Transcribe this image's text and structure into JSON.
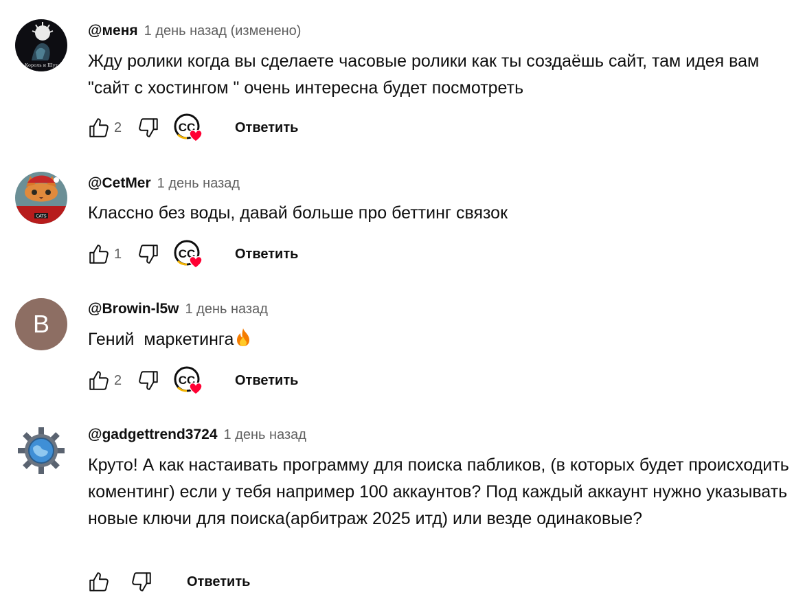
{
  "comments": [
    {
      "author": "@меня",
      "time": "1 день назад (изменено)",
      "text": "Жду ролики когда вы сделаете часовые ролики как ты создаёшь сайт, там идея вам \"сайт с хостингом \" очень интересна будет посмотреть",
      "likes": "2",
      "avatar_caption": "Король и Шут",
      "has_creator_heart": true,
      "reply_label": "Ответить"
    },
    {
      "author": "@CetMer",
      "time": "1 день назад",
      "text": "Классно без воды, давай больше про беттинг связок",
      "likes": "1",
      "avatar_caption": "CATS",
      "has_creator_heart": true,
      "reply_label": "Ответить"
    },
    {
      "author": "@Browin-l5w",
      "time": "1 день назад",
      "text": "Гений  маркетинга",
      "emoji": "fire-emoji",
      "likes": "2",
      "avatar_letter": "B",
      "has_creator_heart": true,
      "reply_label": "Ответить"
    },
    {
      "author": "@gadgettrend3724",
      "time": "1 день назад",
      "text": "Круто! А как настаивать программу для поиска пабликов, (в которых будет происходить коментинг) если у тебя например 100 аккаунтов? Под каждый аккаунт нужно указывать новые ключи для поиска(арбитраж 2025 итд) или везде одинаковые?",
      "likes": "",
      "has_creator_heart": false,
      "reply_label": "Ответить"
    }
  ],
  "creator_heart_badge": "CC",
  "icons": {
    "like": "thumbs-up-icon",
    "dislike": "thumbs-down-icon",
    "heart": "creator-heart-icon"
  },
  "colors": {
    "text": "#0f0f0f",
    "secondary": "#606060",
    "heart": "#ff0033",
    "letter_avatar": "#8d6e63"
  }
}
